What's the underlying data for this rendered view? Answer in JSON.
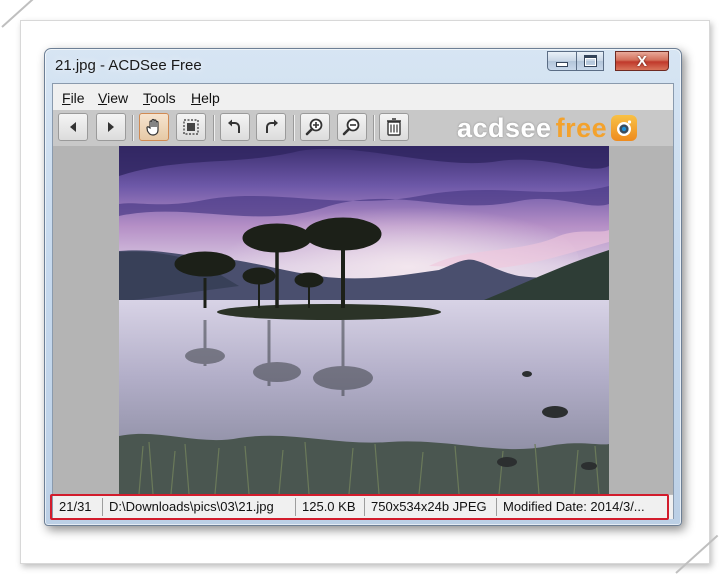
{
  "window": {
    "title": "21.jpg - ACDSee Free",
    "close_glyph": "X"
  },
  "menu": [
    {
      "label": "File",
      "accel": "F",
      "rest": "ile"
    },
    {
      "label": "View",
      "accel": "V",
      "rest": "iew"
    },
    {
      "label": "Tools",
      "accel": "T",
      "rest": "ools"
    },
    {
      "label": "Help",
      "accel": "H",
      "rest": "elp"
    }
  ],
  "toolbar": {
    "buttons": [
      {
        "name": "previous-button",
        "icon": "triangle-left-icon"
      },
      {
        "name": "next-button",
        "icon": "triangle-right-icon"
      },
      {
        "name": "hand-tool-button",
        "icon": "hand-icon",
        "active": true
      },
      {
        "name": "fit-to-window-button",
        "icon": "fit-window-icon"
      },
      {
        "name": "rotate-left-button",
        "icon": "rotate-left-icon"
      },
      {
        "name": "rotate-right-button",
        "icon": "rotate-right-icon"
      },
      {
        "name": "zoom-in-button",
        "icon": "zoom-in-icon"
      },
      {
        "name": "zoom-out-button",
        "icon": "zoom-out-icon"
      },
      {
        "name": "delete-button",
        "icon": "trash-icon"
      }
    ],
    "brand_prefix": "acdsee",
    "brand_suffix": "free",
    "brand_color": "#f3a22d"
  },
  "status": {
    "position": "21/31",
    "path": "D:\\Downloads\\pics\\03\\21.jpg",
    "size": "125.0 KB",
    "dimensions": "750x534x24b JPEG",
    "modified": "Modified Date: 2014/3/..."
  },
  "colors": {
    "highlight_outline": "#d21c2c",
    "active_button": "#d08a53"
  }
}
